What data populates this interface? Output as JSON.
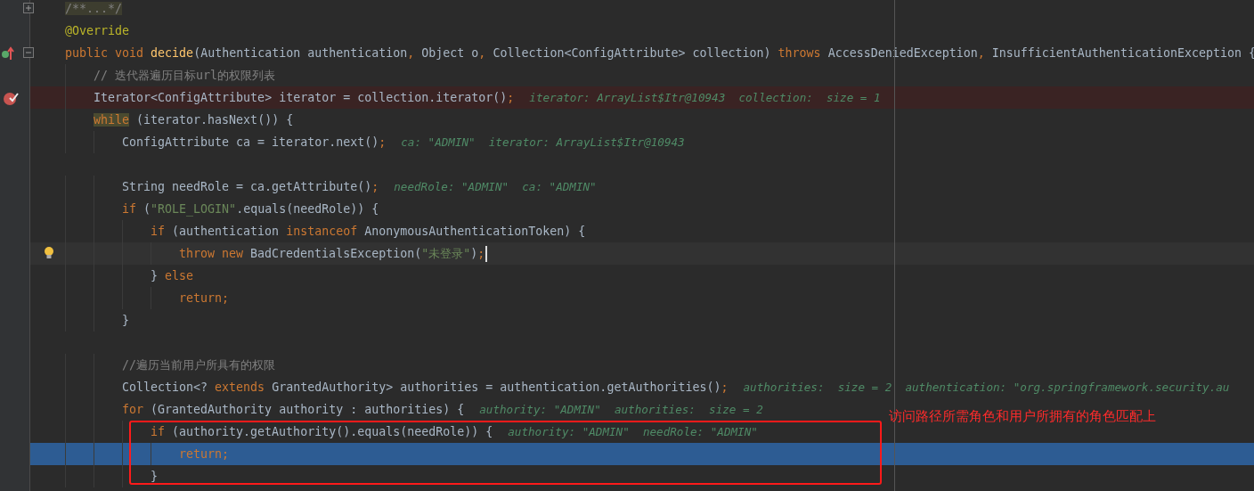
{
  "editor": {
    "lines": [
      {
        "kind": "folded",
        "tokens": [
          {
            "kind": "folded",
            "text": "/**...*/"
          }
        ]
      },
      {
        "kind": "plain",
        "tokens": [
          {
            "kind": "annotation",
            "text": "@Override"
          }
        ]
      },
      {
        "kind": "declaration",
        "tokens": [
          {
            "kind": "keyword",
            "text": "public void "
          },
          {
            "kind": "method",
            "text": "decide"
          },
          {
            "kind": "plain",
            "text": "(Authentication authentication"
          },
          {
            "kind": "keyword",
            "text": ", "
          },
          {
            "kind": "plain",
            "text": "Object o"
          },
          {
            "kind": "keyword",
            "text": ", "
          },
          {
            "kind": "plain",
            "text": "Collection<ConfigAttribute> collection) "
          },
          {
            "kind": "keyword",
            "text": "throws "
          },
          {
            "kind": "plain",
            "text": "AccessDeniedException"
          },
          {
            "kind": "keyword",
            "text": ", "
          },
          {
            "kind": "plain",
            "text": "InsufficientAuthenticationException {"
          }
        ]
      },
      {
        "kind": "plain",
        "tokens": [
          {
            "kind": "comment",
            "text": "    // 迭代器遍历目标url的权限列表"
          }
        ]
      },
      {
        "kind": "breakpoint",
        "tokens": [
          {
            "kind": "plain",
            "text": "    Iterator<ConfigAttribute> iterator = collection.iterator()"
          },
          {
            "kind": "keyword",
            "text": ";"
          }
        ],
        "hint": "iterator: ArrayList$Itr@10943  collection:  size = 1"
      },
      {
        "kind": "plain",
        "tokens": [
          {
            "kind": "match",
            "text": "    while"
          },
          {
            "kind": "plain",
            "text": " (iterator.hasNext()) {"
          }
        ]
      },
      {
        "kind": "plain",
        "tokens": [
          {
            "kind": "plain",
            "text": "        ConfigAttribute ca = iterator.next()"
          },
          {
            "kind": "keyword",
            "text": ";"
          }
        ],
        "hint": "ca: \"ADMIN\"  iterator: ArrayList$Itr@10943"
      },
      {
        "kind": "plain"
      },
      {
        "kind": "plain",
        "tokens": [
          {
            "kind": "plain",
            "text": "        String needRole = ca.getAttribute()"
          },
          {
            "kind": "keyword",
            "text": ";"
          }
        ],
        "hint": "needRole: \"ADMIN\"  ca: \"ADMIN\""
      },
      {
        "kind": "plain",
        "tokens": [
          {
            "kind": "keyword",
            "text": "        if "
          },
          {
            "kind": "plain",
            "text": "("
          },
          {
            "kind": "string",
            "text": "\"ROLE_LOGIN\""
          },
          {
            "kind": "plain",
            "text": ".equals(needRole)) {"
          }
        ]
      },
      {
        "kind": "plain",
        "tokens": [
          {
            "kind": "keyword",
            "text": "            if "
          },
          {
            "kind": "plain",
            "text": "(authentication "
          },
          {
            "kind": "keyword",
            "text": "instanceof "
          },
          {
            "kind": "plain",
            "text": "AnonymousAuthenticationToken) {"
          }
        ]
      },
      {
        "kind": "caret",
        "tokens": [
          {
            "kind": "keyword",
            "text": "                throw new "
          },
          {
            "kind": "plain",
            "text": "BadCredentialsException("
          },
          {
            "kind": "string",
            "text": "\"未登录\""
          },
          {
            "kind": "plain",
            "text": ")"
          },
          {
            "kind": "keyword",
            "text": ";"
          }
        ]
      },
      {
        "kind": "plain",
        "tokens": [
          {
            "kind": "plain",
            "text": "            } "
          },
          {
            "kind": "keyword",
            "text": "else"
          }
        ]
      },
      {
        "kind": "plain",
        "tokens": [
          {
            "kind": "keyword",
            "text": "                return;"
          }
        ]
      },
      {
        "kind": "plain",
        "tokens": [
          {
            "kind": "plain",
            "text": "        }"
          }
        ]
      },
      {
        "kind": "plain"
      },
      {
        "kind": "plain",
        "tokens": [
          {
            "kind": "comment",
            "text": "        //遍历当前用户所具有的权限"
          }
        ]
      },
      {
        "kind": "plain",
        "tokens": [
          {
            "kind": "plain",
            "text": "        Collection<? "
          },
          {
            "kind": "keyword",
            "text": "extends "
          },
          {
            "kind": "plain",
            "text": "GrantedAuthority> authorities = authentication.getAuthorities()"
          },
          {
            "kind": "keyword",
            "text": ";"
          }
        ],
        "hint": "authorities:  size = 2  authentication: \"org.springframework.security.au"
      },
      {
        "kind": "plain",
        "tokens": [
          {
            "kind": "keyword",
            "text": "        for "
          },
          {
            "kind": "plain",
            "text": "(GrantedAuthority authority : authorities) {"
          }
        ],
        "hint": "authority: \"ADMIN\"  authorities:  size = 2"
      },
      {
        "kind": "plain",
        "tokens": [
          {
            "kind": "keyword",
            "text": "            if "
          },
          {
            "kind": "plain",
            "text": "(authority.getAuthority().equals(needRole)) {"
          }
        ],
        "hint": "authority: \"ADMIN\"  needRole: \"ADMIN\""
      },
      {
        "kind": "execution",
        "tokens": [
          {
            "kind": "keyword",
            "text": "                return;"
          }
        ]
      },
      {
        "kind": "plain",
        "tokens": [
          {
            "kind": "plain",
            "text": "            }"
          }
        ]
      }
    ]
  },
  "annotation": {
    "note": "访问路径所需角色和用户所拥有的角色匹配上"
  }
}
